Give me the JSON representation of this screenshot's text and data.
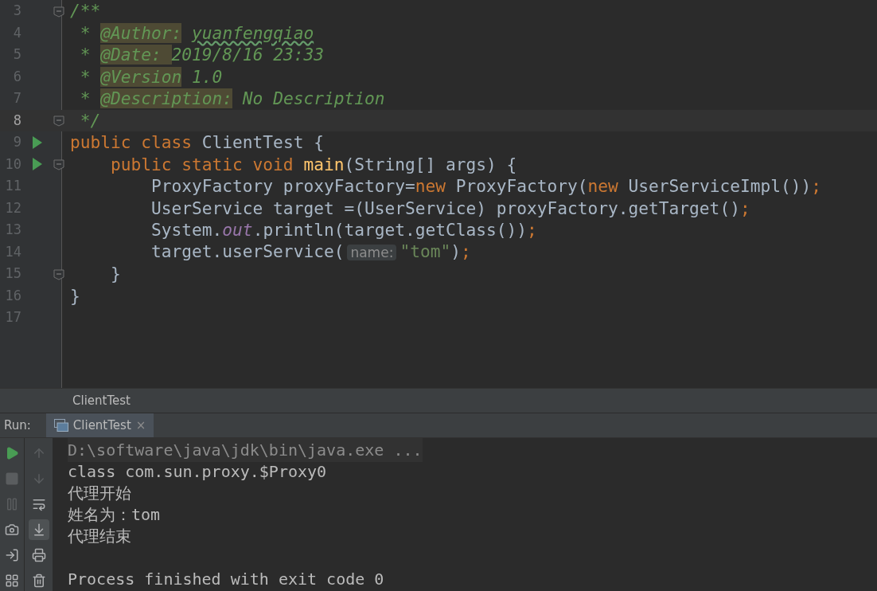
{
  "editor": {
    "lines": [
      {
        "number": "3",
        "current": false,
        "run": false,
        "fold": true,
        "tokens": [
          {
            "text": "/**",
            "kind": "comment"
          }
        ]
      },
      {
        "number": "4",
        "current": false,
        "run": false,
        "fold": false,
        "tokens": [
          {
            "text": " * ",
            "kind": "comment"
          },
          {
            "text": "@Author:",
            "kind": "doc_tag"
          },
          {
            "text": " yuanfengqiao",
            "kind": "comment_typo"
          }
        ]
      },
      {
        "number": "5",
        "current": false,
        "run": false,
        "fold": false,
        "tokens": [
          {
            "text": " * ",
            "kind": "comment"
          },
          {
            "text": "@Date: ",
            "kind": "doc_tag"
          },
          {
            "text": "2019/8/16 23:33",
            "kind": "comment"
          }
        ]
      },
      {
        "number": "6",
        "current": false,
        "run": false,
        "fold": false,
        "tokens": [
          {
            "text": " * ",
            "kind": "comment"
          },
          {
            "text": "@Version",
            "kind": "doc_tag"
          },
          {
            "text": " 1.0",
            "kind": "comment"
          }
        ]
      },
      {
        "number": "7",
        "current": false,
        "run": false,
        "fold": false,
        "tokens": [
          {
            "text": " * ",
            "kind": "comment"
          },
          {
            "text": "@Description:",
            "kind": "doc_tag"
          },
          {
            "text": " No Description",
            "kind": "comment"
          }
        ]
      },
      {
        "number": "8",
        "current": true,
        "run": false,
        "fold": true,
        "tokens": [
          {
            "text": " */",
            "kind": "comment"
          }
        ]
      },
      {
        "number": "9",
        "current": false,
        "run": true,
        "fold": false,
        "tokens": [
          {
            "text": "public class ",
            "kind": "keyword"
          },
          {
            "text": "ClientTest {",
            "kind": "plain"
          }
        ]
      },
      {
        "number": "10",
        "current": false,
        "run": true,
        "fold": true,
        "tokens": [
          {
            "text": "    public static void ",
            "kind": "keyword"
          },
          {
            "text": "main",
            "kind": "method"
          },
          {
            "text": "(String[] args) {",
            "kind": "plain"
          }
        ]
      },
      {
        "number": "11",
        "current": false,
        "run": false,
        "fold": false,
        "tokens": [
          {
            "text": "        ProxyFactory proxyFactory=",
            "kind": "plain"
          },
          {
            "text": "new ",
            "kind": "keyword"
          },
          {
            "text": "ProxyFactory(",
            "kind": "plain"
          },
          {
            "text": "new ",
            "kind": "keyword"
          },
          {
            "text": "UserServiceImpl())",
            "kind": "plain"
          },
          {
            "text": ";",
            "kind": "keyword"
          }
        ]
      },
      {
        "number": "12",
        "current": false,
        "run": false,
        "fold": false,
        "tokens": [
          {
            "text": "        UserService target =(UserService) proxyFactory.getTarget()",
            "kind": "plain"
          },
          {
            "text": ";",
            "kind": "keyword"
          }
        ]
      },
      {
        "number": "13",
        "current": false,
        "run": false,
        "fold": false,
        "tokens": [
          {
            "text": "        System.",
            "kind": "plain"
          },
          {
            "text": "out",
            "kind": "static_field"
          },
          {
            "text": ".println(target.getClass())",
            "kind": "plain"
          },
          {
            "text": ";",
            "kind": "keyword"
          }
        ]
      },
      {
        "number": "14",
        "current": false,
        "run": false,
        "fold": false,
        "tokens": [
          {
            "text": "        target.userService(",
            "kind": "plain"
          },
          {
            "text": "name:",
            "kind": "hint"
          },
          {
            "text": "\"tom\"",
            "kind": "string"
          },
          {
            "text": ")",
            "kind": "plain"
          },
          {
            "text": ";",
            "kind": "keyword"
          }
        ]
      },
      {
        "number": "15",
        "current": false,
        "run": false,
        "fold": true,
        "tokens": [
          {
            "text": "    }",
            "kind": "plain"
          }
        ]
      },
      {
        "number": "16",
        "current": false,
        "run": false,
        "fold": false,
        "tokens": [
          {
            "text": "}",
            "kind": "plain"
          }
        ]
      },
      {
        "number": "17",
        "current": false,
        "run": false,
        "fold": false
      }
    ]
  },
  "breadcrumb": "ClientTest",
  "run_panel": {
    "label": "Run:",
    "tabs": [
      {
        "label": "ClientTest",
        "selected": true,
        "close": "×"
      }
    ],
    "left_tools": [
      {
        "kind": "run",
        "disabled": false
      },
      {
        "kind": "stop",
        "disabled": true
      },
      {
        "kind": "pause",
        "disabled": true
      },
      {
        "kind": "camera",
        "disabled": false
      },
      {
        "kind": "exit",
        "disabled": false
      },
      {
        "kind": "layout",
        "disabled": false
      }
    ],
    "right_tools": [
      {
        "kind": "up",
        "disabled": true,
        "on": false
      },
      {
        "kind": "down",
        "disabled": true,
        "on": false
      },
      {
        "kind": "wrap",
        "disabled": false,
        "on": false
      },
      {
        "kind": "scroll_end",
        "disabled": false,
        "on": true
      },
      {
        "kind": "print",
        "disabled": false,
        "on": false
      },
      {
        "kind": "trash",
        "disabled": false,
        "on": false
      }
    ],
    "console": [
      {
        "text": "D:\\software\\java\\jdk\\bin\\java.exe ...",
        "kind": "command"
      },
      {
        "text": "class com.sun.proxy.$Proxy0",
        "kind": "output"
      },
      {
        "text": "代理开始",
        "kind": "output"
      },
      {
        "text": "姓名为：tom",
        "kind": "output"
      },
      {
        "text": "代理结束",
        "kind": "output"
      },
      {
        "kind": "blank"
      },
      {
        "text": "Process finished with exit code 0",
        "kind": "output"
      }
    ]
  }
}
